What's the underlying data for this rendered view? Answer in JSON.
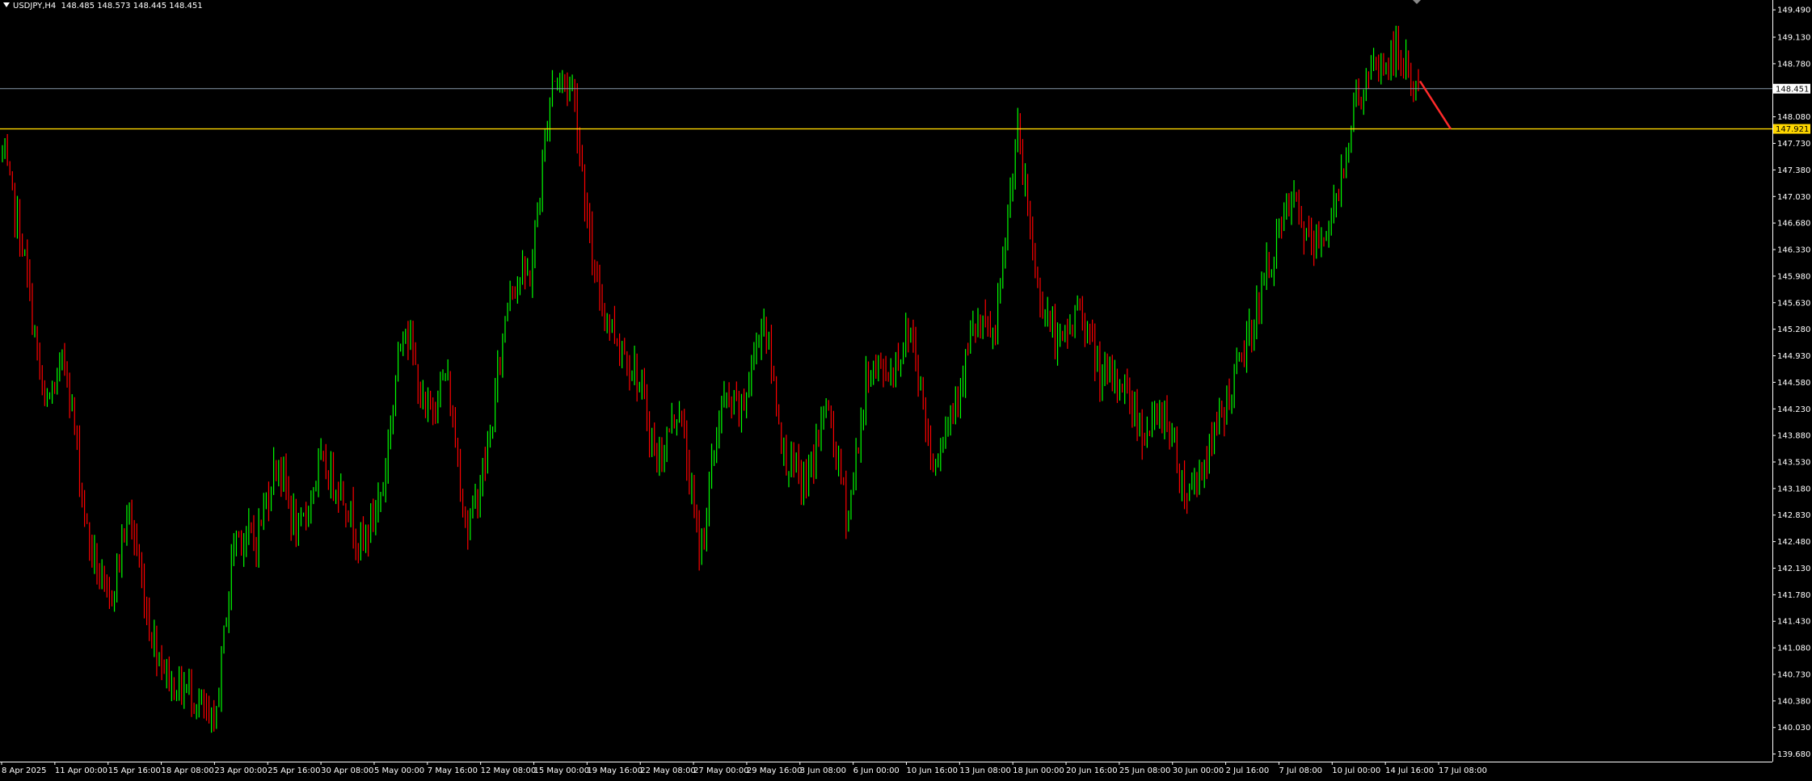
{
  "header": {
    "symbol": "USDJPY,H4",
    "ohlc": "148.485 148.573 148.445 148.451"
  },
  "colors": {
    "background": "#000000",
    "bull": "#00ff00",
    "bear": "#ff0000",
    "axis": "#ffffff",
    "bid_line": "#8899aa",
    "level_line": "#ffd700",
    "arrow": "#ff2a2a"
  },
  "chart_data": {
    "type": "candlestick",
    "y_ticks": [
      "149.490",
      "149.130",
      "148.780",
      "148.080",
      "147.730",
      "147.380",
      "147.030",
      "146.680",
      "146.330",
      "145.980",
      "145.630",
      "145.280",
      "144.930",
      "144.580",
      "144.230",
      "143.880",
      "143.530",
      "143.180",
      "142.830",
      "142.480",
      "142.130",
      "141.780",
      "141.430",
      "141.080",
      "140.730",
      "140.380",
      "140.030",
      "139.680"
    ],
    "x_ticks": [
      "8 Apr 2025",
      "11 Apr 00:00",
      "15 Apr 16:00",
      "18 Apr 08:00",
      "23 Apr 00:00",
      "25 Apr 16:00",
      "30 Apr 08:00",
      "5 May 00:00",
      "7 May 16:00",
      "12 May 08:00",
      "15 May 00:00",
      "19 May 16:00",
      "22 May 08:00",
      "27 May 00:00",
      "29 May 16:00",
      "3 Jun 08:00",
      "6 Jun 00:00",
      "10 Jun 16:00",
      "13 Jun 08:00",
      "18 Jun 00:00",
      "20 Jun 16:00",
      "25 Jun 08:00",
      "30 Jun 00:00",
      "2 Jul 16:00",
      "7 Jul 08:00",
      "10 Jul 00:00",
      "14 Jul 16:00",
      "17 Jul 08:00"
    ],
    "ylim": [
      139.58,
      149.62
    ],
    "bid_price": "148.451",
    "level_price": "147.921",
    "anchors": [
      147.6,
      146.3,
      144.2,
      144.9,
      142.6,
      141.6,
      142.9,
      141.3,
      140.6,
      140.5,
      139.95,
      142.6,
      142.5,
      143.6,
      142.5,
      143.5,
      143.2,
      142.4,
      143.2,
      145.5,
      144.1,
      144.7,
      142.6,
      143.7,
      145.9,
      146.0,
      148.6,
      148.5,
      145.9,
      145.2,
      144.7,
      143.5,
      144.3,
      142.3,
      144.3,
      144.2,
      145.5,
      143.6,
      143.2,
      144.3,
      142.8,
      144.8,
      144.7,
      145.3,
      143.5,
      144.3,
      145.3,
      145.2,
      147.9,
      145.8,
      145.0,
      145.6,
      144.6,
      144.6,
      143.9,
      144.2,
      143.1,
      143.6,
      144.4,
      145.2,
      146.2,
      147.0,
      146.3,
      146.8,
      148.3,
      148.7,
      148.9,
      148.451
    ]
  }
}
